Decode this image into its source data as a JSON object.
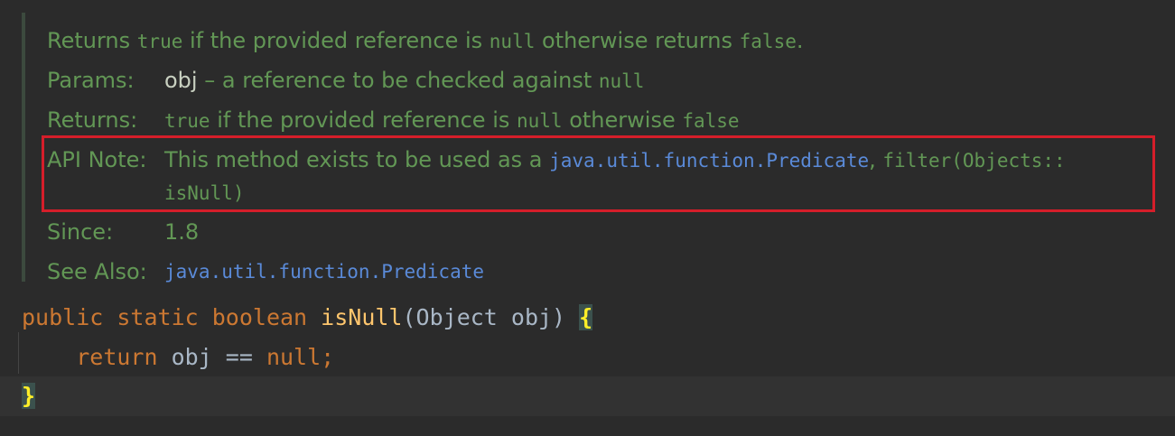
{
  "doc": {
    "returns_summary": {
      "t1": "Returns ",
      "c1": "true",
      "t2": " if the provided reference is ",
      "c2": "null",
      "t3": " otherwise returns ",
      "c3": "false",
      "t4": "."
    },
    "params": {
      "label": "Params:",
      "name": "obj",
      "t1": " – a reference to be checked against ",
      "c1": "null"
    },
    "returns": {
      "label": "Returns:",
      "c1": "true",
      "t1": " if the provided reference is ",
      "c2": "null",
      "t2": " otherwise ",
      "c3": "false"
    },
    "api_note": {
      "label": "API Note:",
      "t1": "This method exists to be used as a ",
      "link": "java.util.function.Predicate",
      "t2": ", ",
      "c1": "filter(Objects::",
      "c2": "isNull)"
    },
    "since": {
      "label": "Since:",
      "value": "1.8"
    },
    "see_also": {
      "label": "See Also:",
      "link": "java.util.function.Predicate"
    }
  },
  "code": {
    "line1": {
      "kw1": "public",
      "kw2": "static",
      "kw3": "boolean",
      "fn": "isNull",
      "params": "(Object obj) ",
      "brace": "{"
    },
    "line2": {
      "kw": "return",
      "expr": " obj == ",
      "kw_null": "null",
      "semi": ";"
    },
    "line3": {
      "brace": "}"
    }
  },
  "colors": {
    "background": "#2b2b2b",
    "doc_text": "#629755",
    "link": "#5a8ad8",
    "keyword": "#cc7832",
    "function": "#ffc66d",
    "plain": "#a9b7c6",
    "highlight_box": "#d51e2a"
  }
}
